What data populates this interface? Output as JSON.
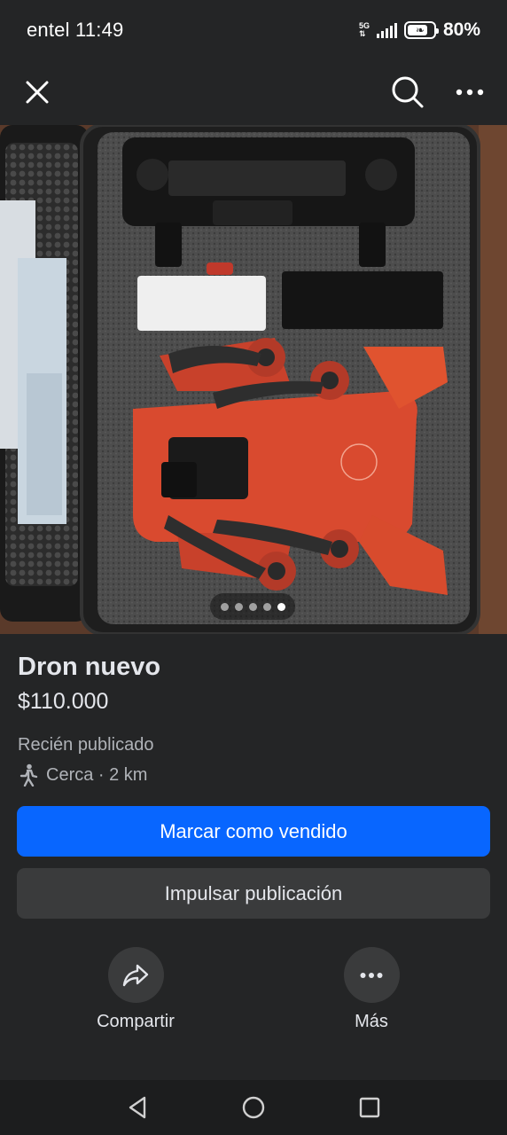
{
  "status_bar": {
    "carrier": "entel",
    "time": "11:49",
    "network": "5G",
    "battery": "80%",
    "battery_level": 0.8
  },
  "top_bar": {
    "close_icon": "close-icon",
    "search_icon": "search-icon",
    "more_icon": "more-icon"
  },
  "photo": {
    "count": 5,
    "active_index": 5
  },
  "listing": {
    "title": "Dron nuevo",
    "price": "$110.000",
    "posted": "Recién publicado",
    "location_icon": "walking-icon",
    "location": "Cerca · 2 km"
  },
  "buttons": {
    "mark_sold": "Marcar como vendido",
    "boost": "Impulsar publicación"
  },
  "actions": {
    "share": {
      "label": "Compartir",
      "icon": "share-icon"
    },
    "more": {
      "label": "Más",
      "icon": "more-icon"
    }
  },
  "nav": {
    "back_icon": "back-icon",
    "home_icon": "home-icon",
    "recents_icon": "recents-icon"
  },
  "colors": {
    "background": "#242526",
    "primary": "#0866ff",
    "secondary": "#3a3b3c"
  }
}
